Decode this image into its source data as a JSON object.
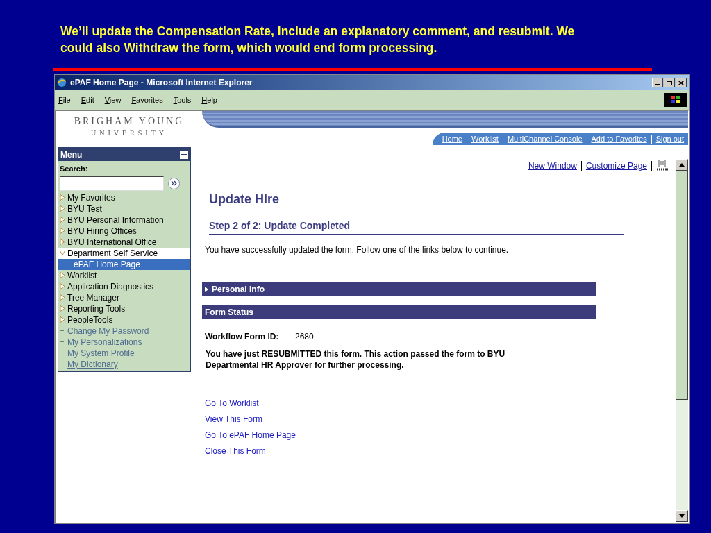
{
  "caption": "We’ll update the Compensation Rate, include an explanatory comment, and resubmit. We could also Withdraw the form, which would end form processing.",
  "window": {
    "title": "ePAF Home Page - Microsoft Internet Explorer"
  },
  "menu_bar": [
    "File",
    "Edit",
    "View",
    "Favorites",
    "Tools",
    "Help"
  ],
  "header": {
    "logo_line_1": "BRIGHAM YOUNG",
    "logo_line_2": "UNIVERSITY",
    "links": [
      "Home",
      "Worklist",
      "MultiChannel Console",
      "Add to Favorites",
      "Sign out"
    ]
  },
  "sidebar": {
    "title": "Menu",
    "search_label": "Search:",
    "items": [
      {
        "label": "My Favorites",
        "kind": "folder",
        "selected": false
      },
      {
        "label": "BYU Test",
        "kind": "folder",
        "selected": false
      },
      {
        "label": "BYU Personal Information",
        "kind": "folder",
        "selected": false
      },
      {
        "label": "BYU Hiring Offices",
        "kind": "folder",
        "selected": false
      },
      {
        "label": "BYU International Office",
        "kind": "folder",
        "selected": false
      },
      {
        "label": "Department Self Service",
        "kind": "open",
        "selected": false,
        "children": [
          {
            "label": "ePAF Home Page",
            "kind": "page",
            "selected": true
          }
        ]
      },
      {
        "label": "Worklist",
        "kind": "folder",
        "selected": false
      },
      {
        "label": "Application Diagnostics",
        "kind": "folder",
        "selected": false
      },
      {
        "label": "Tree Manager",
        "kind": "folder",
        "selected": false
      },
      {
        "label": "Reporting Tools",
        "kind": "folder",
        "selected": false
      },
      {
        "label": "PeopleTools",
        "kind": "folder",
        "selected": false
      },
      {
        "label": "Change My Password",
        "kind": "link",
        "selected": false
      },
      {
        "label": "My Personalizations",
        "kind": "link",
        "selected": false
      },
      {
        "label": "My System Profile",
        "kind": "link",
        "selected": false
      },
      {
        "label": "My Dictionary",
        "kind": "link",
        "selected": false
      }
    ]
  },
  "page_links": [
    "New Window",
    "Customize Page"
  ],
  "page": {
    "title": "Update Hire",
    "step": "Step 2 of 2: Update Completed",
    "message": "You have successfully updated the form. Follow one of the links below to continue.",
    "sections": [
      {
        "label": "Personal Info",
        "expandable": true
      },
      {
        "label": "Form Status",
        "expandable": false
      }
    ],
    "form_id_label": "Workflow Form ID:",
    "form_id": "2680",
    "status_message": "You have just RESUBMITTED this form. This action passed the form to BYU Departmental HR Approver for further processing.",
    "links": [
      "Go To Worklist",
      "View This Form",
      "Go To ePAF Home Page",
      "Close This Form"
    ]
  }
}
